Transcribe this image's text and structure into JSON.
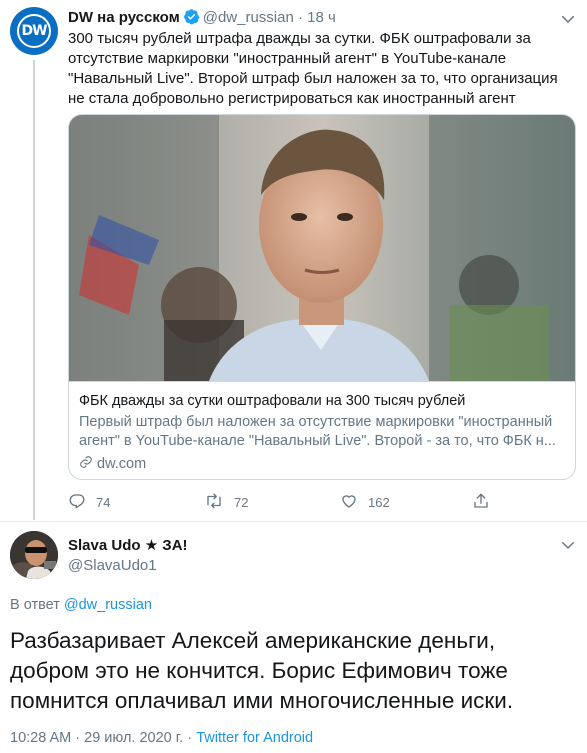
{
  "tweet1": {
    "author_name": "DW на русском",
    "avatar_text": "DW",
    "handle": "@dw_russian",
    "separator": "·",
    "time": "18 ч",
    "text": "300 тысяч рублей штрафа дважды за сутки. ФБК оштрафовали за отсутствие маркировки \"иностранный агент\" в YouTube-канале \"Навальный Live\". Второй штраф был наложен за то, что организация не стала добровольно регистрироваться как иностранный агент",
    "card": {
      "title": "ФБК дважды за сутки оштрафовали на 300 тысяч рублей",
      "description": "Первый штраф был наложен за отсутствие маркировки \"иностранный агент\" в YouTube-канале \"Навальный Live\". Второй - за то, что ФБК н...",
      "domain": "dw.com"
    },
    "actions": {
      "replies": "74",
      "retweets": "72",
      "likes": "162"
    }
  },
  "tweet2": {
    "author_name": "Slava Udo ★ ЗА!",
    "handle": "@SlavaUdo1",
    "reply_prefix": "В ответ",
    "reply_to": "@dw_russian",
    "text": "Разбазаривает Алексей американские деньги, добром это не кончится. Борис Ефимович тоже помнится оплачивал ими многочисленные иски.",
    "timestamp": "10:28 AM · 29 июл. 2020 г. ·",
    "source": "Twitter for Android"
  },
  "colors": {
    "link": "#1b95e0",
    "muted": "#657786",
    "text": "#14171a",
    "border": "#ccd6dd",
    "dw_blue": "#0a6fc2"
  },
  "icons": [
    "verified-badge-icon",
    "chevron-down-icon",
    "reply-icon",
    "retweet-icon",
    "like-icon",
    "share-icon",
    "link-icon"
  ]
}
